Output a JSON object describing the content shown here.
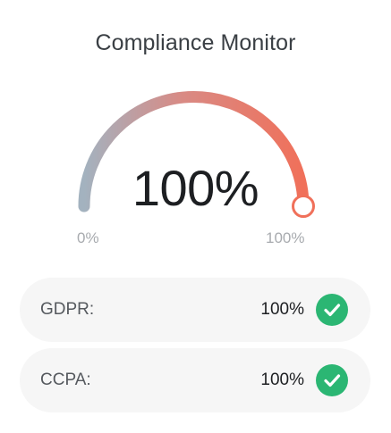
{
  "title": "Compliance Monitor",
  "gauge": {
    "value_text": "100%",
    "level": 1.0,
    "min_label": "0%",
    "max_label": "100%",
    "colors": {
      "start": "#a3b2bf",
      "mid": "#d98a84",
      "end": "#f0705a"
    }
  },
  "items": [
    {
      "label": "GDPR:",
      "value": "100%",
      "status_icon": "check-circle-icon"
    },
    {
      "label": "CCPA:",
      "value": "100%",
      "status_icon": "check-circle-icon"
    }
  ],
  "accent_colors": {
    "ok": "#2bb673"
  }
}
